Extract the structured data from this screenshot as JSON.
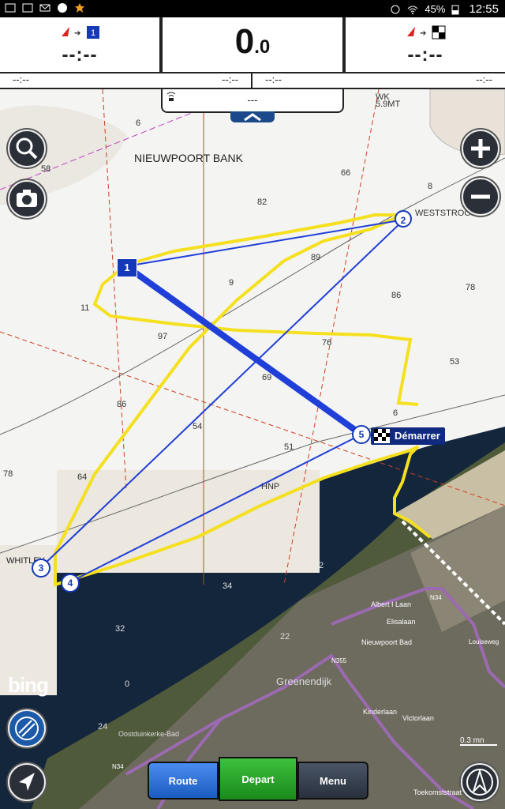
{
  "status_bar": {
    "battery": "45%",
    "time": "12:55"
  },
  "top_panels": {
    "left": {
      "value": "--:--",
      "icon": "arrow-to-waypoint-1"
    },
    "center": {
      "value_int": "0",
      "value_dec": ".0"
    },
    "right": {
      "value": "--:--",
      "icon": "arrow-to-finish"
    },
    "bottom_left": {
      "a": "--:--",
      "b": "--:--"
    },
    "bottom_right": {
      "a": "--:--",
      "b": "--:--"
    },
    "sub_value": "---"
  },
  "map": {
    "place_labels": [
      "NIEUWPOORT BANK",
      "WESTSTROOM B",
      "WHITLEY",
      "WK",
      "5.9MT",
      "HNP",
      "Greenendijk",
      "Oostduinkerke-Bad",
      "Albert I Laan",
      "N34",
      "N355",
      "Nieuwpoort Bad",
      "Kinderlaan",
      "Victorlaan",
      "Toekomststraat",
      "Louiseweg",
      "Elisalaan",
      "N34"
    ],
    "depths": [
      "6",
      "58",
      "66",
      "82",
      "8",
      "89",
      "9",
      "86",
      "78",
      "11",
      "97",
      "76",
      "53",
      "69",
      "86",
      "6",
      "51",
      "64",
      "78",
      "54",
      "34",
      "32",
      "22",
      "24",
      "0",
      "2"
    ],
    "waypoints": [
      "1",
      "2",
      "3",
      "4",
      "5"
    ],
    "start_label": "Démarrer",
    "scale": "0.3 mn",
    "attribution": "bing"
  },
  "buttons": {
    "route": "Route",
    "depart": "Depart",
    "menu": "Menu"
  },
  "colors": {
    "route_line": "#1f3fd8",
    "track": "#f5e020",
    "waypoint_fill": "#1438b8"
  }
}
